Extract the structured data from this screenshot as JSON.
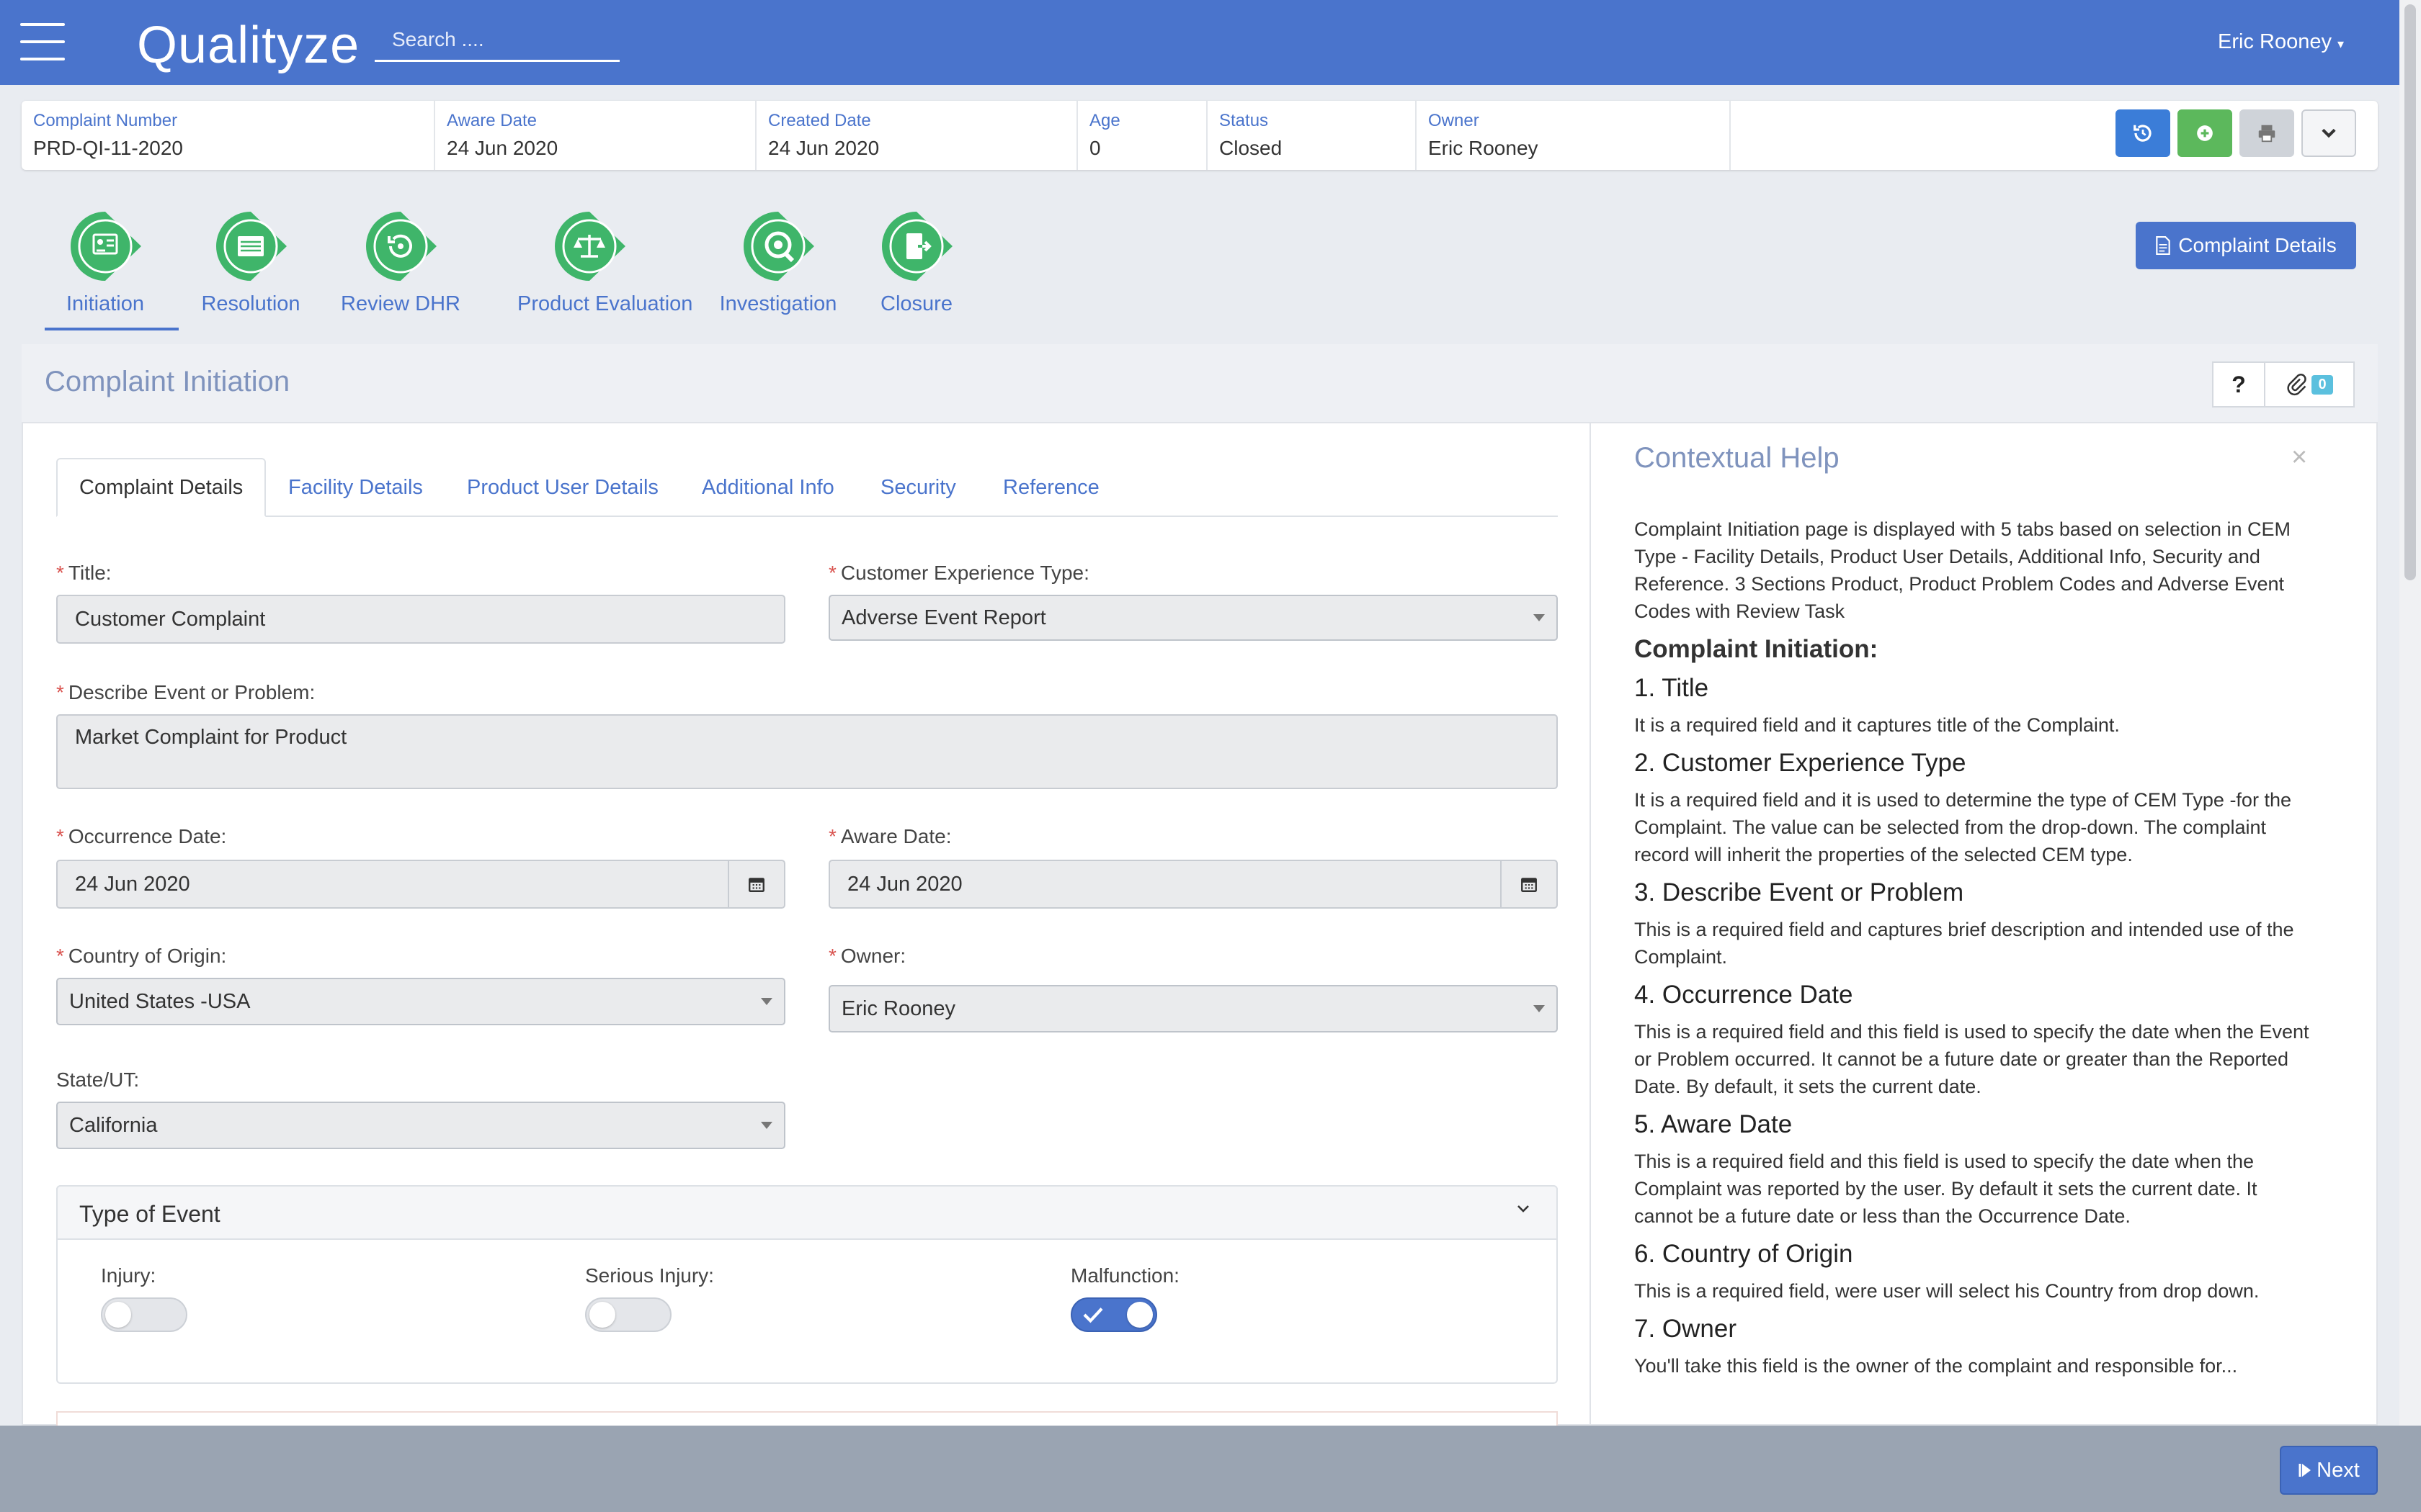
{
  "app": {
    "name": "Qualityze",
    "search_placeholder": "Search ....",
    "user": "Eric Rooney"
  },
  "header": {
    "fields": [
      {
        "label": "Complaint Number",
        "value": "PRD-QI-11-2020"
      },
      {
        "label": "Aware Date",
        "value": "24 Jun 2020"
      },
      {
        "label": "Created Date",
        "value": "24 Jun 2020"
      },
      {
        "label": "Age",
        "value": "0"
      },
      {
        "label": "Status",
        "value": "Closed"
      },
      {
        "label": "Owner",
        "value": "Eric Rooney"
      }
    ],
    "buttons": [
      {
        "name": "history",
        "color": "#3b7dd8"
      },
      {
        "name": "add",
        "color": "#5cb85c"
      },
      {
        "name": "print",
        "color": "#cfd3d9"
      },
      {
        "name": "more",
        "color": "#f4f5f7"
      }
    ]
  },
  "workflow": {
    "steps": [
      "Initiation",
      "Resolution",
      "Review DHR",
      "Product Evaluation",
      "Investigation",
      "Closure"
    ],
    "active": "Initiation",
    "step_color": "#3fb56a",
    "complaint_details_button": "Complaint Details"
  },
  "panel": {
    "title": "Complaint Initiation",
    "help_button": "?",
    "attachments_count": "0"
  },
  "tabs": [
    "Complaint Details",
    "Facility Details",
    "Product User Details",
    "Additional Info",
    "Security",
    "Reference"
  ],
  "form": {
    "title": {
      "label": "Title:",
      "value": "Customer Complaint"
    },
    "cem_type": {
      "label": "Customer Experience Type:",
      "value": "Adverse Event Report"
    },
    "describe": {
      "label": "Describe Event or Problem:",
      "value": "Market Complaint for Product"
    },
    "occurrence_date": {
      "label": "Occurrence Date:",
      "value": "24 Jun 2020"
    },
    "aware_date": {
      "label": "Aware Date:",
      "value": "24 Jun 2020"
    },
    "country": {
      "label": "Country of Origin:",
      "value": "United States -USA"
    },
    "owner": {
      "label": "Owner:",
      "value": "Eric Rooney"
    },
    "state": {
      "label": "State/UT:",
      "value": "California"
    },
    "required_marker": "*"
  },
  "type_of_event": {
    "title": "Type of Event",
    "toggles": [
      {
        "label": "Injury:",
        "on": false
      },
      {
        "label": "Serious Injury:",
        "on": false
      },
      {
        "label": "Malfunction:",
        "on": true
      }
    ]
  },
  "help": {
    "title": "Contextual Help",
    "close": "×",
    "intro": "Complaint Initiation page is displayed with 5 tabs based on selection in CEM Type - Facility Details, Product User Details, Additional Info, Security and Reference. 3 Sections Product, Product Problem Codes and Adverse Event Codes with Review Task",
    "section_title": "Complaint Initiation:",
    "items": [
      {
        "heading": "1. Title",
        "text": "It is a required field and it captures title of the Complaint."
      },
      {
        "heading": "2. Customer Experience Type",
        "text": "It is a required field and it is used to determine the type of CEM Type -for the Complaint. The value can be selected from the drop-down. The complaint record will inherit the properties of the selected CEM type."
      },
      {
        "heading": "3. Describe Event or Problem",
        "text": "This is a required field and captures brief description and intended use of the Complaint."
      },
      {
        "heading": "4. Occurrence Date",
        "text": "This is a required field and this field is used to specify the date when the Event or Problem occurred. It cannot be a future date or greater than the Reported Date. By default, it sets the current date."
      },
      {
        "heading": "5. Aware Date",
        "text": "This is a required field and this field is used to specify the date when the Complaint was reported by the user. By default it sets the current date. It cannot be a future date or less than the Occurrence Date."
      },
      {
        "heading": "6. Country of Origin",
        "text": "This is a required field, were user will select his Country from drop down."
      },
      {
        "heading": "7. Owner",
        "text": "You'll take this field is the owner of the complaint and responsible for..."
      }
    ]
  },
  "footer": {
    "next_label": "Next"
  }
}
